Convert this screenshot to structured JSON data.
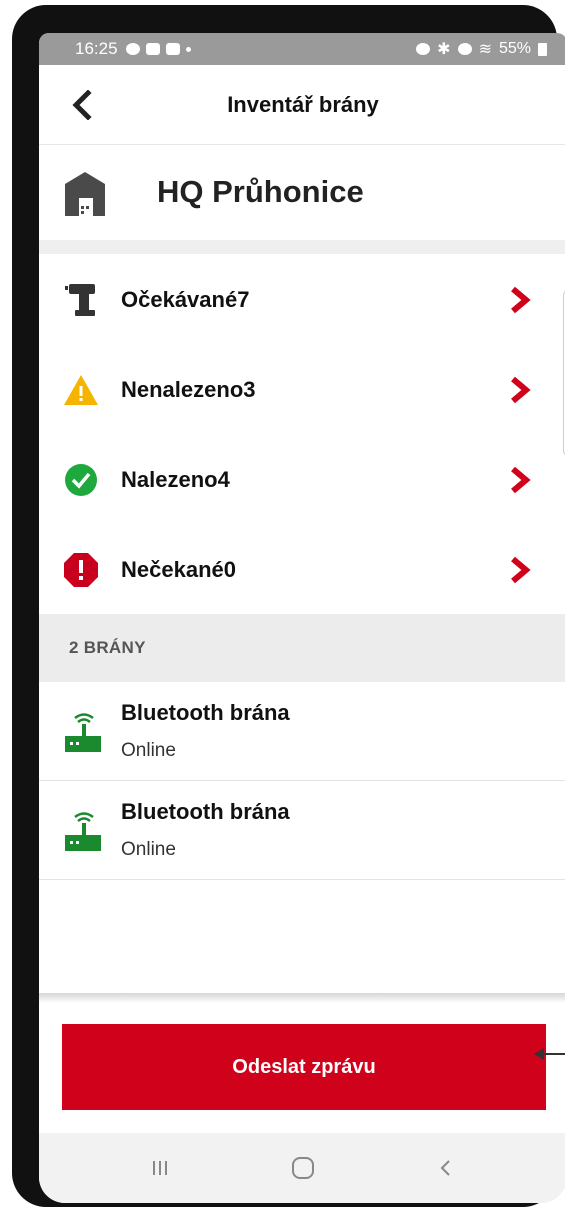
{
  "status_bar": {
    "time": "16:25",
    "battery": "55%"
  },
  "header": {
    "title": "Inventář brány"
  },
  "site": {
    "name": "HQ Průhonice"
  },
  "statuses": [
    {
      "label": "Očekávané7",
      "icon": "drill-icon"
    },
    {
      "label": "Nenalezeno3",
      "icon": "warning-icon"
    },
    {
      "label": "Nalezeno4",
      "icon": "check-icon"
    },
    {
      "label": "Nečekané0",
      "icon": "stop-alert-icon"
    }
  ],
  "gateways_section": {
    "title": "2 BRÁNY",
    "items": [
      {
        "name": "Bluetooth brána",
        "status": "Online"
      },
      {
        "name": "Bluetooth brána",
        "status": "Online"
      }
    ]
  },
  "actions": {
    "send_label": "Odeslat zprávu"
  },
  "colors": {
    "accent": "#d0021b",
    "warning": "#f5b400",
    "success": "#1fa83d",
    "danger": "#c8001e",
    "gateway": "#1b8a2e"
  }
}
